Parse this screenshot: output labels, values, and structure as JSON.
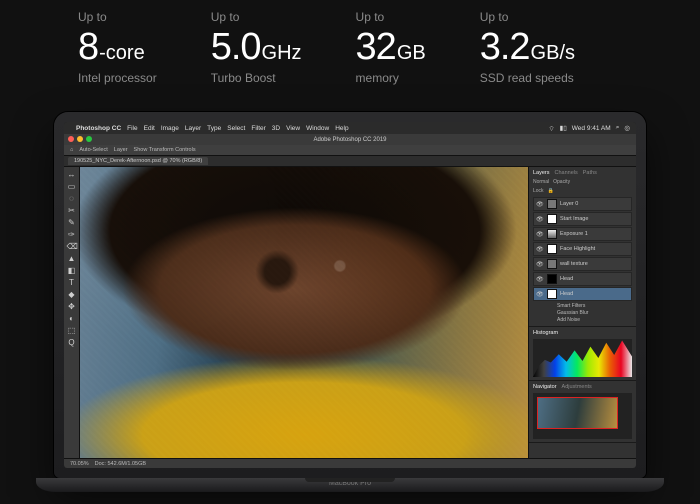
{
  "specs": [
    {
      "upto": "Up to",
      "num": "8",
      "unit": "-core",
      "sub": "Intel processor"
    },
    {
      "upto": "Up to",
      "num": "5.0",
      "unit": "GHz",
      "sub": "Turbo Boost"
    },
    {
      "upto": "Up to",
      "num": "32",
      "unit": "GB",
      "sub": "memory"
    },
    {
      "upto": "Up to",
      "num": "3.2",
      "unit": "GB/s",
      "sub": "SSD read speeds"
    }
  ],
  "laptop_label": "MacBook Pro",
  "menubar": {
    "app": "Photoshop CC",
    "items": [
      "File",
      "Edit",
      "Image",
      "Layer",
      "Type",
      "Select",
      "Filter",
      "3D",
      "View",
      "Window",
      "Help"
    ],
    "right": {
      "time": "Wed 9:41 AM"
    }
  },
  "ps": {
    "title": "Adobe Photoshop CC 2019",
    "toolbar_labels": [
      "Auto-Select",
      "Layer",
      "Show Transform Controls"
    ],
    "doc_tab": "190525_NYC_Derek-Afternoon.psd @ 70% (RGB/8)",
    "status": {
      "zoom": "70.05%",
      "doc": "Doc: 542.6M/1.05GB"
    },
    "panels": {
      "layers_tabs": [
        "Layers",
        "Channels",
        "Paths"
      ],
      "blend_mode": "Normal",
      "opacity_label": "Opacity",
      "lock_label": "Lock",
      "layers": [
        {
          "name": "Layer 0",
          "thumb": "g"
        },
        {
          "name": "Start Image",
          "thumb": "w"
        },
        {
          "name": "Exposure 1",
          "thumb": "fx"
        },
        {
          "name": "Face Highlight",
          "thumb": "w"
        },
        {
          "name": "wall texture",
          "thumb": "g"
        },
        {
          "name": "Head",
          "thumb": "k"
        },
        {
          "name": "Head",
          "thumb": "w",
          "selected": true
        }
      ],
      "smart_filters_label": "Smart Filters",
      "smart_filters": [
        "Gaussian Blur",
        "Add Noise"
      ],
      "histogram_label": "Histogram",
      "navigator_tabs": [
        "Navigator",
        "Adjustments"
      ]
    },
    "tool_glyphs": [
      "↔",
      "▭",
      "◌",
      "✂",
      "✎",
      "✑",
      "⌫",
      "▲",
      "◧",
      "T",
      "◆",
      "✥",
      "▤",
      "⊕",
      "◐",
      "⬚",
      "Q"
    ]
  }
}
